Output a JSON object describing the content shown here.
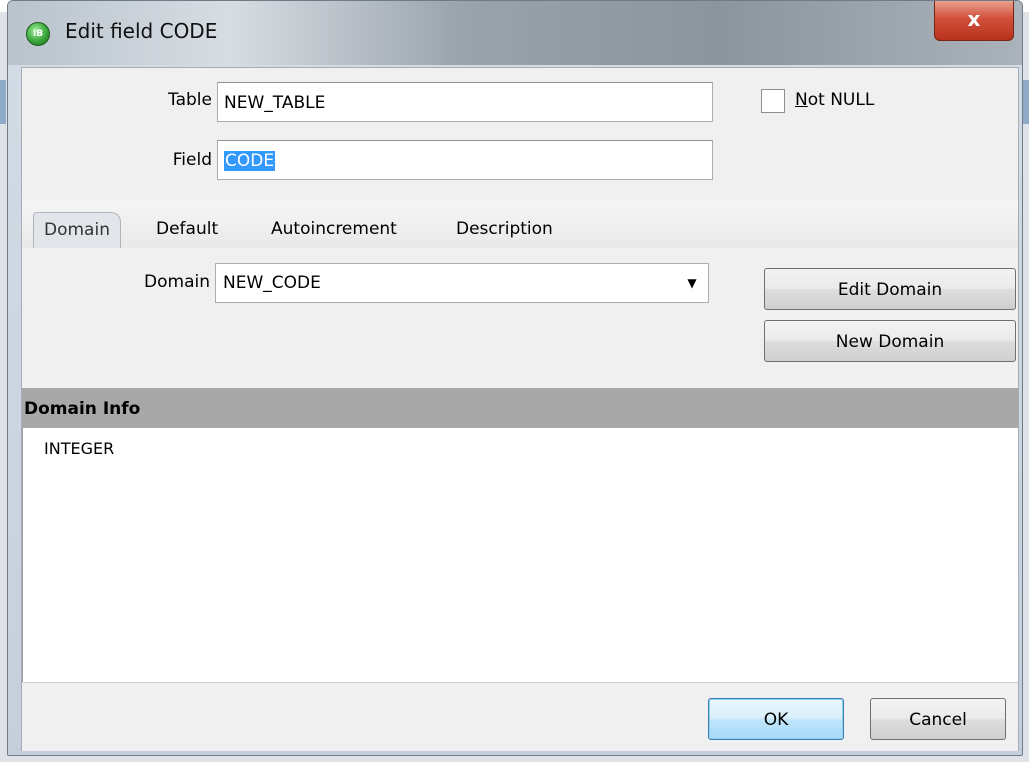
{
  "window": {
    "title": "Edit field CODE",
    "app_icon": "ib-app-icon",
    "close_glyph": "x"
  },
  "form": {
    "table_label": "Table",
    "table_value": "NEW_TABLE",
    "field_label": "Field",
    "field_value": "CODE",
    "not_null_label_prefix": "",
    "not_null_label_underlined": "N",
    "not_null_label_rest": "ot NULL",
    "not_null_checked": false
  },
  "tabs": [
    {
      "label": "Domain",
      "active": true
    },
    {
      "label": "Default",
      "active": false
    },
    {
      "label": "Autoincrement",
      "active": false
    },
    {
      "label": "Description",
      "active": false
    }
  ],
  "domain_tab": {
    "domain_label": "Domain",
    "domain_value": "NEW_CODE",
    "dropdown_icon": "chevron-down-icon",
    "edit_domain_label": "Edit Domain",
    "new_domain_label": "New Domain"
  },
  "domain_info": {
    "header": "Domain Info",
    "text": "INTEGER"
  },
  "footer": {
    "ok_label": "OK",
    "cancel_label": "Cancel"
  }
}
